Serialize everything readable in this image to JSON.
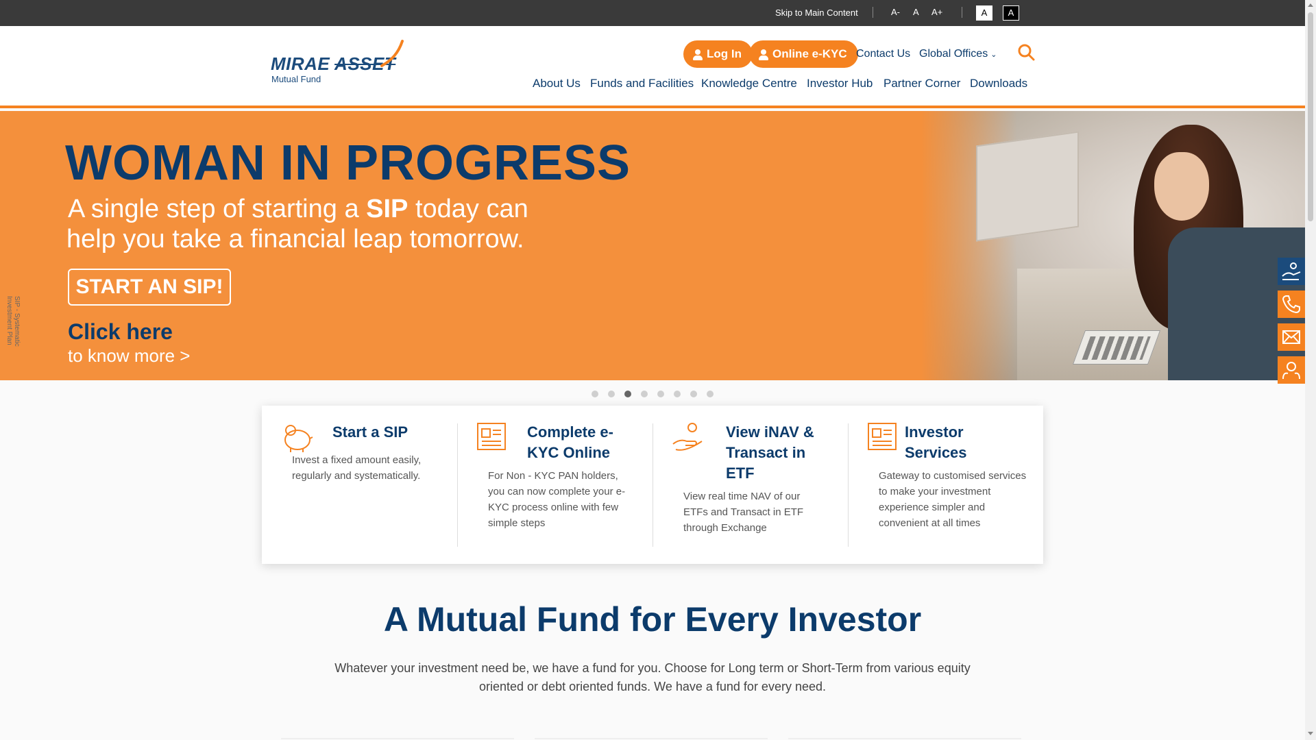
{
  "accessibility_bar": {
    "skip_link": "Skip to Main Content",
    "font_decrease": "A-",
    "font_normal": "A",
    "font_increase": "A+",
    "theme_light": "A",
    "theme_dark": "A"
  },
  "header": {
    "logo_brand_1": "MIRAE",
    "logo_brand_2": "ASSET",
    "logo_sub": "Mutual Fund",
    "login_label": "Log In",
    "ekyc_label": "Online e-KYC",
    "contact_label": "Contact Us",
    "global_offices_label": "Global Offices",
    "nav": [
      "About Us",
      "Funds and Facilities",
      "Knowledge Centre",
      "Investor Hub",
      "Partner Corner",
      "Downloads"
    ]
  },
  "hero": {
    "title": "WOMAN IN PROGRESS",
    "line1_pre": "A single step of starting a ",
    "line1_bold": "SIP",
    "line1_post": " today can",
    "line2": "help you take a financial leap tomorrow.",
    "cta": "START AN SIP!",
    "click": "Click here",
    "know_more": "to know more >",
    "vertical_note": "SIP - Systematic Investment Plan"
  },
  "carousel": {
    "dot_count": 8,
    "active_index": 2
  },
  "cards": [
    {
      "title": "Start a SIP",
      "desc": "Invest a fixed amount easily, regularly and systematically.",
      "icon": "piggy-bank-icon"
    },
    {
      "title": "Complete e-KYC Online",
      "desc": "For Non - KYC PAN holders, you can now complete your e-KYC process online with few simple steps",
      "icon": "document-icon"
    },
    {
      "title": "View iNAV & Transact in ETF",
      "desc": "View real time NAV of our ETFs and Transact in ETF through Exchange",
      "icon": "hand-coin-icon"
    },
    {
      "title": "Investor Services",
      "desc": "Gateway to customised services to make your investment experience simpler and convenient at all times",
      "icon": "document-icon"
    }
  ],
  "section": {
    "title": "A Mutual Fund for Every Investor",
    "desc": "Whatever your investment need be, we have a fund for you. Choose for Long term or Short-Term from various equity oriented or debt oriented funds. We have a fund for every need."
  },
  "side_icons": [
    "invest-icon",
    "phone-icon",
    "mail-icon",
    "support-icon"
  ],
  "colors": {
    "orange": "#f58220",
    "navy": "#0c3b6b",
    "hero_bg": "#f4903c"
  }
}
